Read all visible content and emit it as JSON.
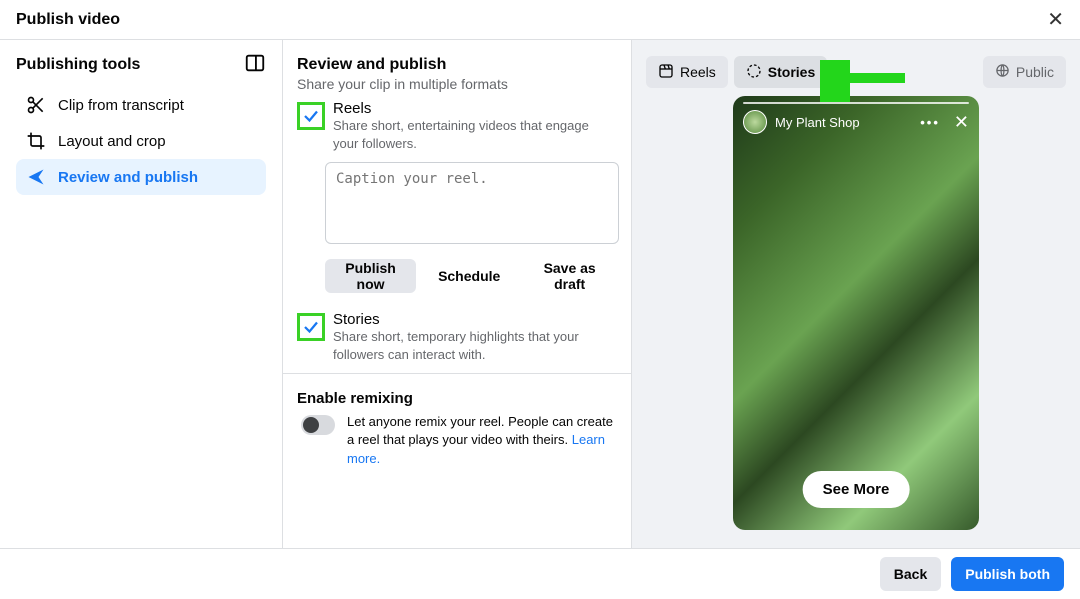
{
  "dialog": {
    "title": "Publish video"
  },
  "sidebar": {
    "title": "Publishing tools",
    "items": [
      {
        "label": "Clip from transcript"
      },
      {
        "label": "Layout and crop"
      },
      {
        "label": "Review and publish"
      }
    ]
  },
  "review": {
    "title": "Review and publish",
    "subtitle": "Share your clip in multiple formats",
    "reels": {
      "label": "Reels",
      "desc": "Share short, entertaining videos that engage your followers."
    },
    "caption_placeholder": "Caption your reel.",
    "buttons": {
      "publish_now": "Publish now",
      "schedule": "Schedule",
      "save_draft": "Save as draft"
    },
    "stories": {
      "label": "Stories",
      "desc": "Share short, temporary highlights that your followers can interact with."
    },
    "remix": {
      "title": "Enable remixing",
      "desc": "Let anyone remix your reel. People can create a reel that plays your video with theirs. ",
      "learn_more": "Learn more."
    }
  },
  "preview": {
    "tabs": {
      "reels": "Reels",
      "stories": "Stories"
    },
    "visibility": "Public",
    "story": {
      "account": "My Plant Shop",
      "cta": "See More"
    }
  },
  "footer": {
    "back": "Back",
    "publish_both": "Publish both"
  }
}
